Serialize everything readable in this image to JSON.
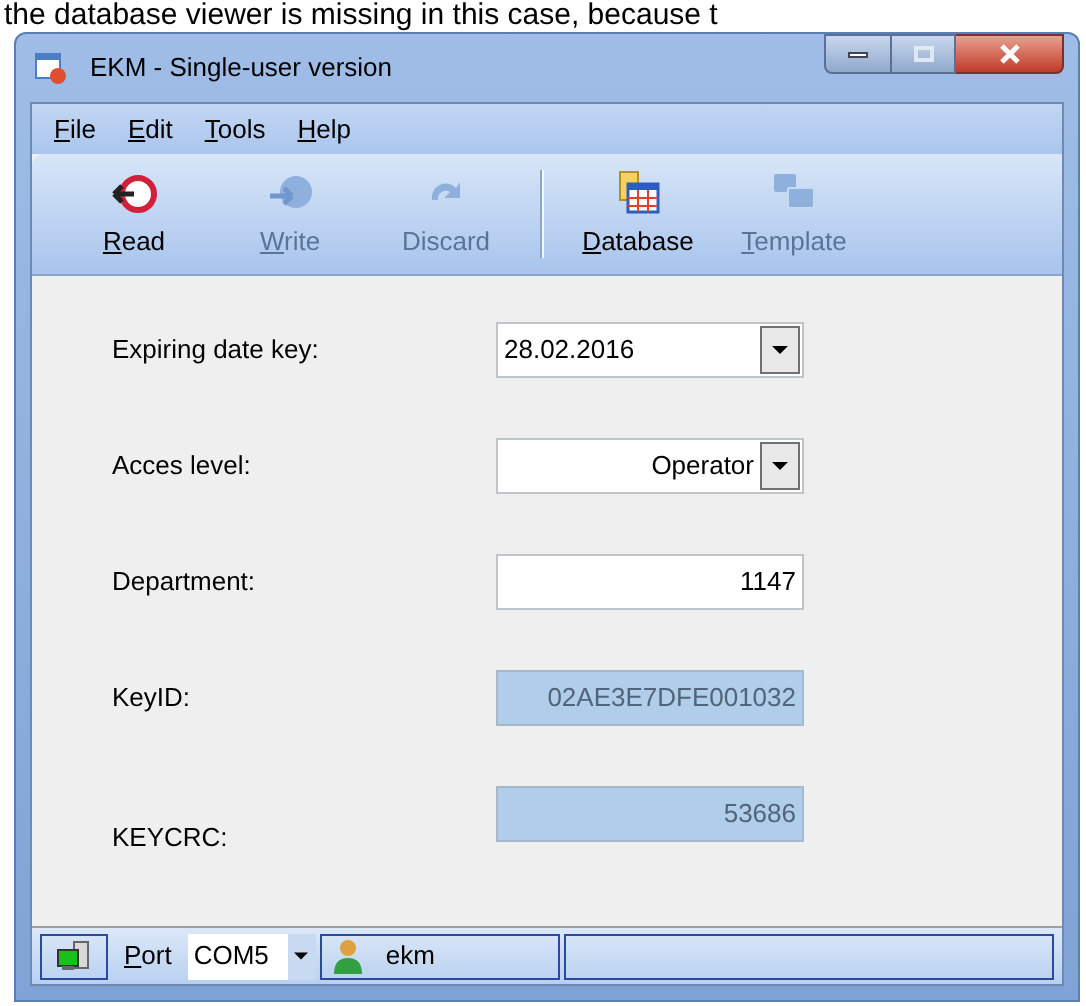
{
  "document_text": "the database viewer is missing in this case, because t",
  "window": {
    "title": "EKM - Single-user version"
  },
  "menu": [
    {
      "label": "File",
      "access_key_underlined": true
    },
    {
      "label": "Edit",
      "access_key_underlined": true
    },
    {
      "label": "Tools",
      "access_key_underlined": true
    },
    {
      "label": "Help",
      "access_key_underlined": true
    }
  ],
  "toolbar": [
    {
      "label": "Read",
      "access_key_underlined": true,
      "kind": "read",
      "disabled": false
    },
    {
      "label": "Write",
      "access_key_underlined": true,
      "kind": "write",
      "disabled": true
    },
    {
      "label": "Discard",
      "access_key_underlined": false,
      "kind": "discard",
      "disabled": true
    },
    {
      "kind": "separator"
    },
    {
      "label": "Database",
      "access_key_underlined": true,
      "kind": "database",
      "disabled": false
    },
    {
      "label": "Template",
      "access_key_underlined": true,
      "kind": "template",
      "disabled": true
    }
  ],
  "form": [
    {
      "label": "Expiring date key:",
      "value": "28.02.2016",
      "kind": "dropdown",
      "right_aligned": false,
      "disabled": false
    },
    {
      "label": "Acces level:",
      "value": "Operator",
      "kind": "dropdown",
      "right_aligned": true,
      "disabled": false
    },
    {
      "label": "Department:",
      "value": "1147",
      "kind": "text",
      "right_aligned": true,
      "disabled": false
    },
    {
      "label": "KeyID:",
      "value": "02AE3E7DFE001032",
      "kind": "text",
      "right_aligned": true,
      "disabled": true
    },
    {
      "label": "KEYCRC:",
      "value": "53686",
      "kind": "text",
      "right_aligned": true,
      "disabled": true
    }
  ],
  "status_bar": {
    "port_label": "Port",
    "port_access_key_underlined": true,
    "port": "COM5",
    "user": "ekm"
  }
}
